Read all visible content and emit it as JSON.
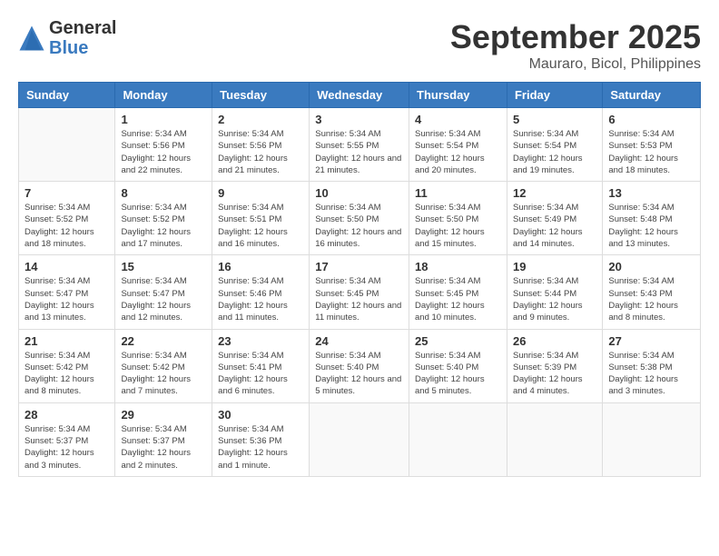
{
  "logo": {
    "general": "General",
    "blue": "Blue"
  },
  "title": "September 2025",
  "location": "Mauraro, Bicol, Philippines",
  "days_of_week": [
    "Sunday",
    "Monday",
    "Tuesday",
    "Wednesday",
    "Thursday",
    "Friday",
    "Saturday"
  ],
  "weeks": [
    [
      {
        "day": "",
        "sunrise": "",
        "sunset": "",
        "daylight": "",
        "empty": true
      },
      {
        "day": "1",
        "sunrise": "Sunrise: 5:34 AM",
        "sunset": "Sunset: 5:56 PM",
        "daylight": "Daylight: 12 hours and 22 minutes."
      },
      {
        "day": "2",
        "sunrise": "Sunrise: 5:34 AM",
        "sunset": "Sunset: 5:56 PM",
        "daylight": "Daylight: 12 hours and 21 minutes."
      },
      {
        "day": "3",
        "sunrise": "Sunrise: 5:34 AM",
        "sunset": "Sunset: 5:55 PM",
        "daylight": "Daylight: 12 hours and 21 minutes."
      },
      {
        "day": "4",
        "sunrise": "Sunrise: 5:34 AM",
        "sunset": "Sunset: 5:54 PM",
        "daylight": "Daylight: 12 hours and 20 minutes."
      },
      {
        "day": "5",
        "sunrise": "Sunrise: 5:34 AM",
        "sunset": "Sunset: 5:54 PM",
        "daylight": "Daylight: 12 hours and 19 minutes."
      },
      {
        "day": "6",
        "sunrise": "Sunrise: 5:34 AM",
        "sunset": "Sunset: 5:53 PM",
        "daylight": "Daylight: 12 hours and 18 minutes."
      }
    ],
    [
      {
        "day": "7",
        "sunrise": "Sunrise: 5:34 AM",
        "sunset": "Sunset: 5:52 PM",
        "daylight": "Daylight: 12 hours and 18 minutes."
      },
      {
        "day": "8",
        "sunrise": "Sunrise: 5:34 AM",
        "sunset": "Sunset: 5:52 PM",
        "daylight": "Daylight: 12 hours and 17 minutes."
      },
      {
        "day": "9",
        "sunrise": "Sunrise: 5:34 AM",
        "sunset": "Sunset: 5:51 PM",
        "daylight": "Daylight: 12 hours and 16 minutes."
      },
      {
        "day": "10",
        "sunrise": "Sunrise: 5:34 AM",
        "sunset": "Sunset: 5:50 PM",
        "daylight": "Daylight: 12 hours and 16 minutes."
      },
      {
        "day": "11",
        "sunrise": "Sunrise: 5:34 AM",
        "sunset": "Sunset: 5:50 PM",
        "daylight": "Daylight: 12 hours and 15 minutes."
      },
      {
        "day": "12",
        "sunrise": "Sunrise: 5:34 AM",
        "sunset": "Sunset: 5:49 PM",
        "daylight": "Daylight: 12 hours and 14 minutes."
      },
      {
        "day": "13",
        "sunrise": "Sunrise: 5:34 AM",
        "sunset": "Sunset: 5:48 PM",
        "daylight": "Daylight: 12 hours and 13 minutes."
      }
    ],
    [
      {
        "day": "14",
        "sunrise": "Sunrise: 5:34 AM",
        "sunset": "Sunset: 5:47 PM",
        "daylight": "Daylight: 12 hours and 13 minutes."
      },
      {
        "day": "15",
        "sunrise": "Sunrise: 5:34 AM",
        "sunset": "Sunset: 5:47 PM",
        "daylight": "Daylight: 12 hours and 12 minutes."
      },
      {
        "day": "16",
        "sunrise": "Sunrise: 5:34 AM",
        "sunset": "Sunset: 5:46 PM",
        "daylight": "Daylight: 12 hours and 11 minutes."
      },
      {
        "day": "17",
        "sunrise": "Sunrise: 5:34 AM",
        "sunset": "Sunset: 5:45 PM",
        "daylight": "Daylight: 12 hours and 11 minutes."
      },
      {
        "day": "18",
        "sunrise": "Sunrise: 5:34 AM",
        "sunset": "Sunset: 5:45 PM",
        "daylight": "Daylight: 12 hours and 10 minutes."
      },
      {
        "day": "19",
        "sunrise": "Sunrise: 5:34 AM",
        "sunset": "Sunset: 5:44 PM",
        "daylight": "Daylight: 12 hours and 9 minutes."
      },
      {
        "day": "20",
        "sunrise": "Sunrise: 5:34 AM",
        "sunset": "Sunset: 5:43 PM",
        "daylight": "Daylight: 12 hours and 8 minutes."
      }
    ],
    [
      {
        "day": "21",
        "sunrise": "Sunrise: 5:34 AM",
        "sunset": "Sunset: 5:42 PM",
        "daylight": "Daylight: 12 hours and 8 minutes."
      },
      {
        "day": "22",
        "sunrise": "Sunrise: 5:34 AM",
        "sunset": "Sunset: 5:42 PM",
        "daylight": "Daylight: 12 hours and 7 minutes."
      },
      {
        "day": "23",
        "sunrise": "Sunrise: 5:34 AM",
        "sunset": "Sunset: 5:41 PM",
        "daylight": "Daylight: 12 hours and 6 minutes."
      },
      {
        "day": "24",
        "sunrise": "Sunrise: 5:34 AM",
        "sunset": "Sunset: 5:40 PM",
        "daylight": "Daylight: 12 hours and 5 minutes."
      },
      {
        "day": "25",
        "sunrise": "Sunrise: 5:34 AM",
        "sunset": "Sunset: 5:40 PM",
        "daylight": "Daylight: 12 hours and 5 minutes."
      },
      {
        "day": "26",
        "sunrise": "Sunrise: 5:34 AM",
        "sunset": "Sunset: 5:39 PM",
        "daylight": "Daylight: 12 hours and 4 minutes."
      },
      {
        "day": "27",
        "sunrise": "Sunrise: 5:34 AM",
        "sunset": "Sunset: 5:38 PM",
        "daylight": "Daylight: 12 hours and 3 minutes."
      }
    ],
    [
      {
        "day": "28",
        "sunrise": "Sunrise: 5:34 AM",
        "sunset": "Sunset: 5:37 PM",
        "daylight": "Daylight: 12 hours and 3 minutes."
      },
      {
        "day": "29",
        "sunrise": "Sunrise: 5:34 AM",
        "sunset": "Sunset: 5:37 PM",
        "daylight": "Daylight: 12 hours and 2 minutes."
      },
      {
        "day": "30",
        "sunrise": "Sunrise: 5:34 AM",
        "sunset": "Sunset: 5:36 PM",
        "daylight": "Daylight: 12 hours and 1 minute."
      },
      {
        "day": "",
        "sunrise": "",
        "sunset": "",
        "daylight": "",
        "empty": true
      },
      {
        "day": "",
        "sunrise": "",
        "sunset": "",
        "daylight": "",
        "empty": true
      },
      {
        "day": "",
        "sunrise": "",
        "sunset": "",
        "daylight": "",
        "empty": true
      },
      {
        "day": "",
        "sunrise": "",
        "sunset": "",
        "daylight": "",
        "empty": true
      }
    ]
  ]
}
